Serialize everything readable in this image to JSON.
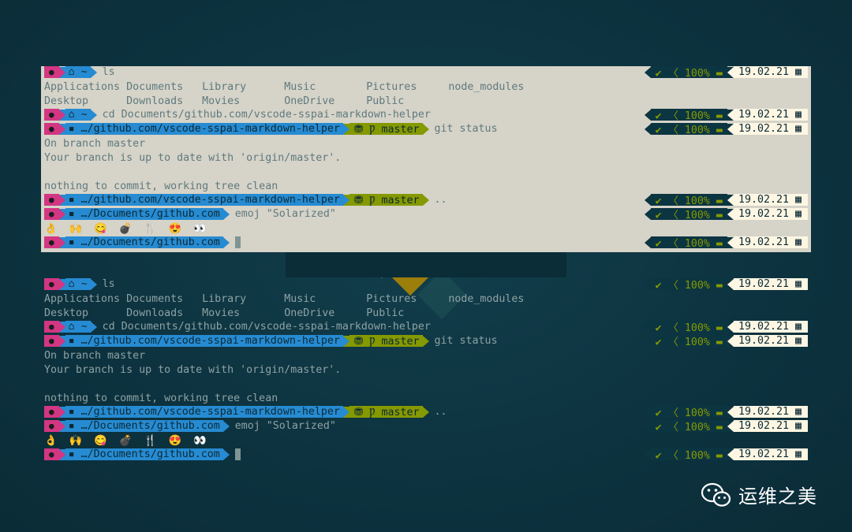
{
  "colors": {
    "accent_magenta": "#d33682",
    "accent_blue": "#268bd2",
    "accent_green": "#859900",
    "status_bg": "#0c3542",
    "date_bg": "#fdf6e3",
    "light_terminal_bg": "#d6d3c8",
    "page_bg": "#0e3440"
  },
  "segments": {
    "apple_icon": "apple-icon",
    "home_glyph": "⌂ ~",
    "folder_glyph": "▪",
    "branch_glyph": "⛃ Ƿ master",
    "status_text": "✔ 〈 100% ▬",
    "date_text": "19.02.21 ▦"
  },
  "terminals": {
    "light": {
      "l1_cmd": "ls",
      "ls_row1": "Applications Documents   Library      Music        Pictures     node_modules",
      "ls_row2": "Desktop      Downloads   Movies       OneDrive     Public",
      "l4_cmd": "cd Documents/github.com/vscode-sspai-markdown-helper",
      "l5_dir": "…/github.com/vscode-sspai-markdown-helper",
      "l5_cmd": "git status",
      "out1": "On branch master",
      "out2": "Your branch is up to date with 'origin/master'.",
      "out3": "nothing to commit, working tree clean",
      "l10_dir": "…/github.com/vscode-sspai-markdown-helper",
      "l10_cmd": "..",
      "l11_dir": "…/Documents/github.com",
      "l11_cmd": "emoj \"Solarized\"",
      "emojis": [
        "👌",
        "🙌",
        "😋",
        "💣",
        "🍴",
        "😍",
        "👀"
      ],
      "l13_dir": "…/Documents/github.com"
    },
    "dark": {
      "l1_cmd": "ls",
      "ls_row1": "Applications Documents   Library      Music        Pictures     node_modules",
      "ls_row2": "Desktop      Downloads   Movies       OneDrive     Public",
      "l4_cmd": "cd Documents/github.com/vscode-sspai-markdown-helper",
      "l5_dir": "…/github.com/vscode-sspai-markdown-helper",
      "l5_cmd": "git status",
      "out1": "On branch master",
      "out2": "Your branch is up to date with 'origin/master'.",
      "out3": "nothing to commit, working tree clean",
      "l10_dir": "…/github.com/vscode-sspai-markdown-helper",
      "l10_cmd": "..",
      "l11_dir": "…/Documents/github.com",
      "l11_cmd": "emoj \"Solarized\"",
      "emojis": [
        "👌",
        "🙌",
        "😋",
        "💣",
        "🍴",
        "😍",
        "👀"
      ],
      "l13_dir": "…/Documents/github.com"
    }
  },
  "watermark": {
    "icon": "wechat-icon",
    "text": "运维之美"
  }
}
